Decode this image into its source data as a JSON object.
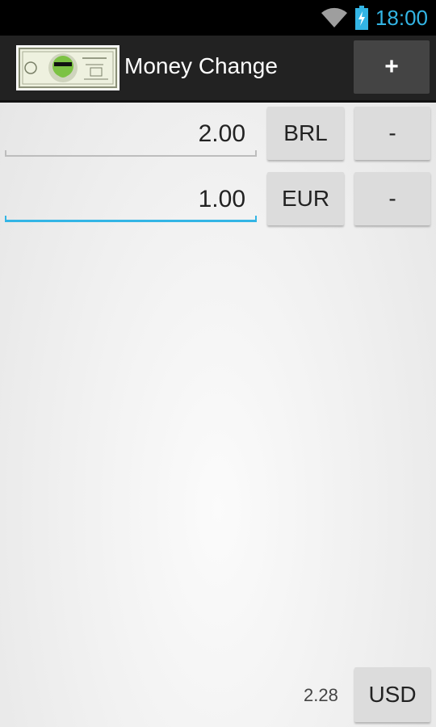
{
  "status_bar": {
    "time": "18:00",
    "wifi_icon": "wifi-icon",
    "battery_icon": "battery-charging-icon"
  },
  "action_bar": {
    "title": "Money Change",
    "add_label": "+",
    "logo_icon": "dollar-bill-android-logo"
  },
  "rows": [
    {
      "amount": "2.00",
      "currency": "BRL",
      "remove_label": "-",
      "focused": false
    },
    {
      "amount": "1.00",
      "currency": "EUR",
      "remove_label": "-",
      "focused": true
    }
  ],
  "footer": {
    "result": "2.28",
    "base_currency": "USD"
  },
  "colors": {
    "accent": "#33b5e5",
    "action_bar": "#222222",
    "button": "#dcdcdc"
  }
}
